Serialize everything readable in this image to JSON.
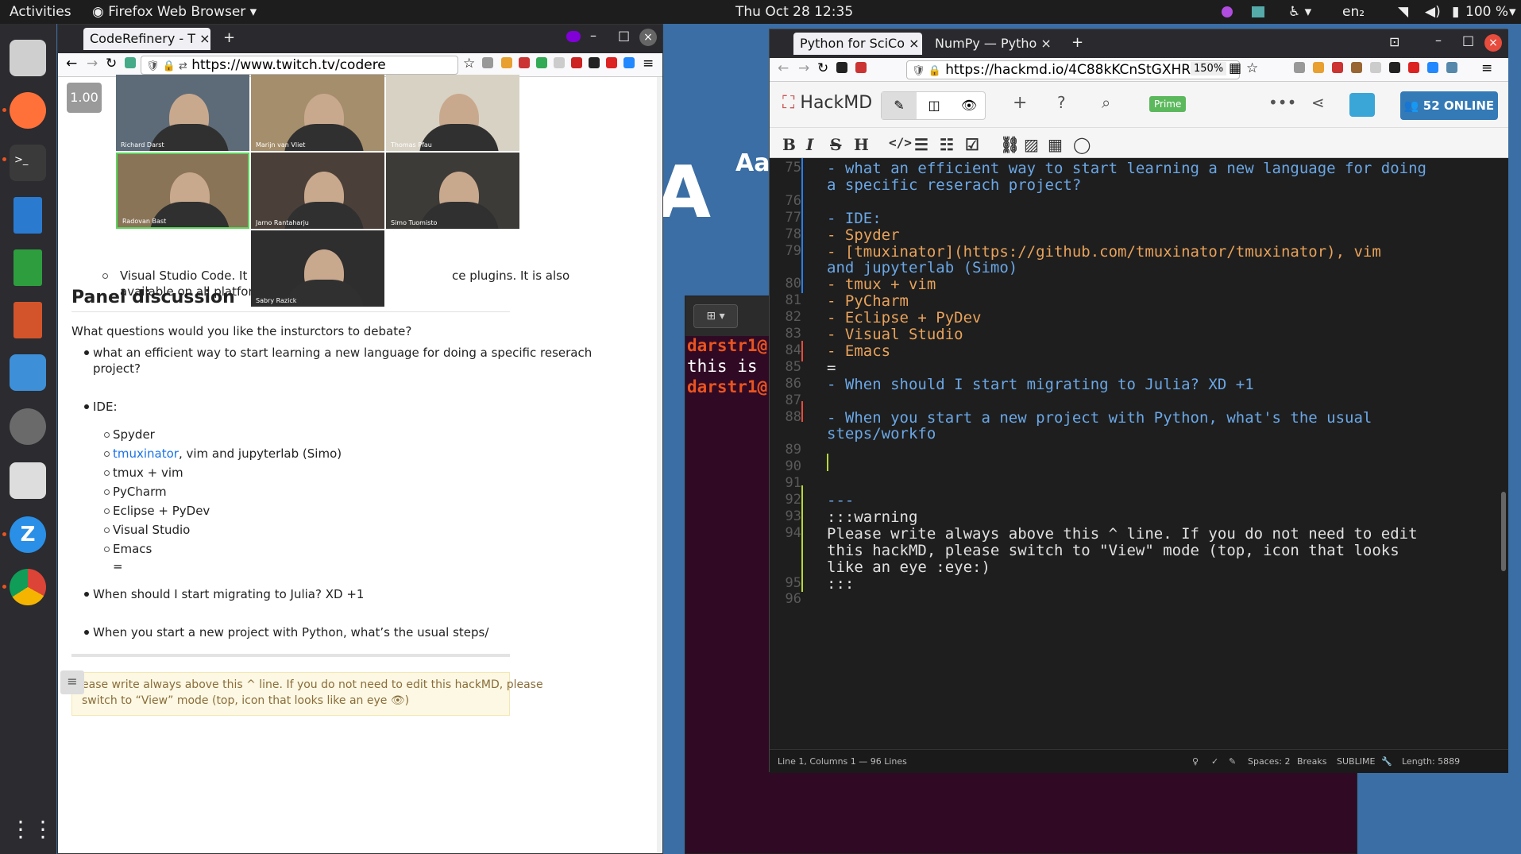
{
  "topbar": {
    "activities": "Activities",
    "app": "Firefox Web Browser",
    "datetime": "Thu Oct 28  12:35",
    "lang": "en₂",
    "battery": "100 %"
  },
  "left_browser": {
    "tab_title": "CodeRefinery - T",
    "url": "https://www.twitch.tv/codere",
    "zoom_badge": "1.00",
    "video_names": [
      "Richard Darst",
      "Marijn van Vliet",
      "Thomas Pfau",
      "Radovan Bast",
      "Jarno Rantaharju",
      "Simo Tuomisto",
      "Sabry Razick"
    ],
    "above_text": [
      "Visual Studio Code. It suppor",
      "available on all platforms afai",
      "ce plugins. It is also"
    ],
    "heading": "Panel discussion",
    "question": "What questions would you like the insturctors to debate?",
    "bullet1": "what an efficient way to start learning a new language for doing a specific reserach",
    "bullet1b": "project?",
    "ide": "IDE:",
    "ide_items": [
      "Spyder",
      "tmuxinator",
      "tmux + vim",
      "PyCharm",
      "Eclipse + PyDev",
      "Visual Studio",
      "Emacs"
    ],
    "tmux_rest": ", vim and jupyterlab (Simo)",
    "eq": "=",
    "bullet_julia": "When should I start migrating to Julia? XD +1",
    "bullet_python": "When you start a new project with Python, what’s the usual steps/",
    "warning_l1": "ease write always above this ^ line. If you do not need to edit this hackMD, please",
    "warning_l2": "switch to “View” mode (top, icon that looks like an eye"
  },
  "terminal": {
    "l1": "darstr1@",
    "l2": "this is ",
    "l3": "darstr1@"
  },
  "right_browser": {
    "tab1": "Python for SciCo",
    "tab2": "NumPy — Pytho",
    "url": "https://hackmd.io/4C88kKCnStGXHR",
    "zoom": "150%",
    "brand": "HackMD",
    "prime": "Prime",
    "online": "52 ONLINE",
    "toolbar": [
      "B",
      "I",
      "S",
      "H"
    ],
    "lines": [
      {
        "n": "75",
        "t": "- what an efficient way to start learning a new language for doing"
      },
      {
        "n": "",
        "t": "a specific reserach project?"
      },
      {
        "n": "76",
        "t": ""
      },
      {
        "n": "77",
        "t": "- IDE:"
      },
      {
        "n": "78",
        "t": "  - Spyder"
      },
      {
        "n": "79",
        "t": "  - [tmuxinator](https://github.com/tmuxinator/tmuxinator), vim"
      },
      {
        "n": "",
        "t": "and jupyterlab (Simo)"
      },
      {
        "n": "80",
        "t": "  - tmux + vim"
      },
      {
        "n": "81",
        "t": "  - PyCharm"
      },
      {
        "n": "82",
        "t": "  - Eclipse + PyDev"
      },
      {
        "n": "83",
        "t": "  - Visual Studio"
      },
      {
        "n": "84",
        "t": "  - Emacs"
      },
      {
        "n": "85",
        "t": "="
      },
      {
        "n": "86",
        "t": "- When should I start migrating to Julia? XD +1"
      },
      {
        "n": "87",
        "t": ""
      },
      {
        "n": "88",
        "t": "- When you start a new project with Python, what's the usual"
      },
      {
        "n": "",
        "t": "steps/workfo"
      },
      {
        "n": "89",
        "t": ""
      },
      {
        "n": "90",
        "t": ""
      },
      {
        "n": "91",
        "t": ""
      },
      {
        "n": "92",
        "t": "---"
      },
      {
        "n": "93",
        "t": ":::warning"
      },
      {
        "n": "94",
        "t": "Please write always above this ^ line. If you do not need to edit"
      },
      {
        "n": "",
        "t": "this hackMD, please switch to  \"View\" mode (top, icon that looks"
      },
      {
        "n": "",
        "t": "like an eye :eye:)"
      },
      {
        "n": "95",
        "t": ":::"
      },
      {
        "n": "96",
        "t": ""
      }
    ],
    "status": {
      "pos": "Line 1, Columns 1 — 96 Lines",
      "spaces": "Spaces: 2",
      "breaks": "Breaks",
      "mode": "SUBLIME",
      "length": "Length: 5889"
    }
  },
  "bg_text": {
    "aa": "Aa",
    "bang": "A!"
  }
}
